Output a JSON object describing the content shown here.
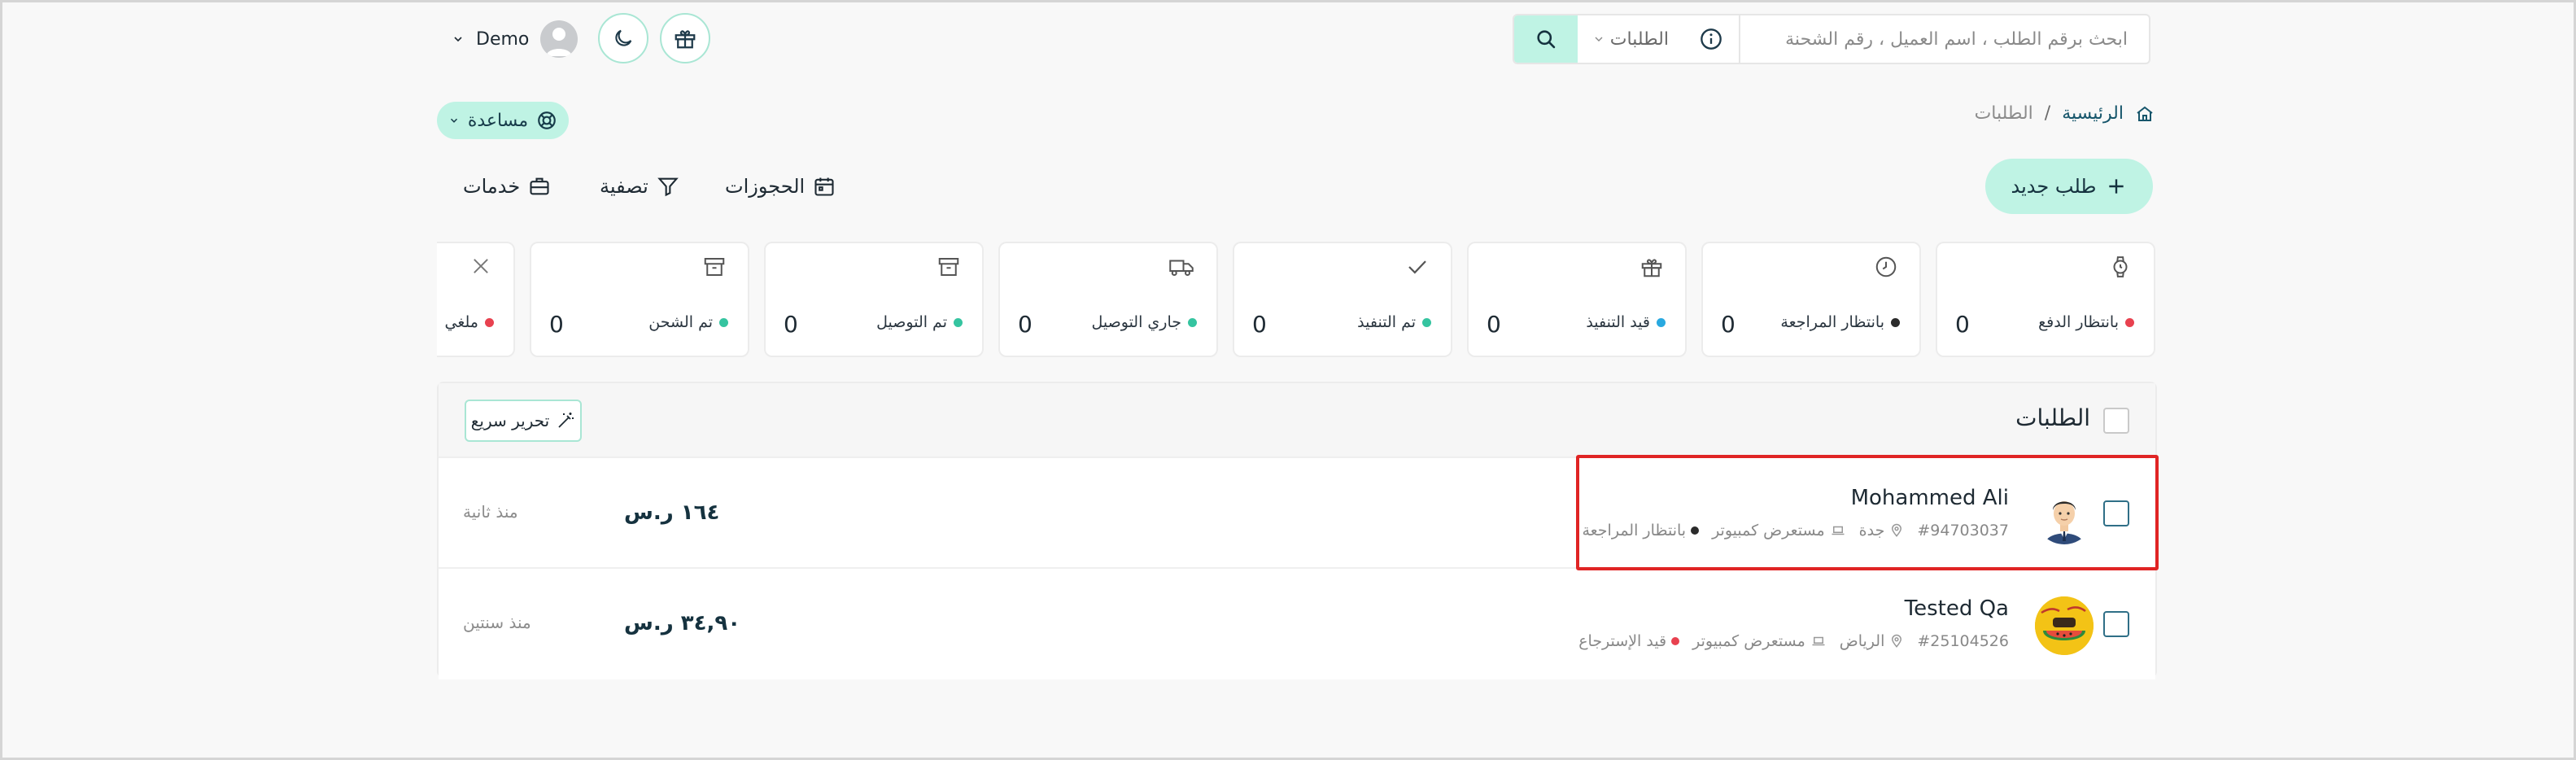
{
  "header": {
    "search_placeholder": "ابحث برقم الطلب ، اسم العميل ، رقم الشحنة",
    "scope_label": "الطلبات",
    "user_name": "Demo"
  },
  "breadcrumb": {
    "home": "الرئيسية",
    "separator": "/",
    "current": "الطلبات"
  },
  "help_label": "مساعدة",
  "actions": {
    "new_order": "طلب جديد",
    "bookings": "الحجوزات",
    "filter": "تصفية",
    "services": "خدمات"
  },
  "status_cards": [
    {
      "label": "بانتظار الدفع",
      "count": "0",
      "dot_color": "#e8414f",
      "icon": "watch-icon"
    },
    {
      "label": "بانتظار المراجعة",
      "count": "0",
      "dot_color": "#2b2b2b",
      "icon": "clock-icon"
    },
    {
      "label": "قيد التنفيذ",
      "count": "0",
      "dot_color": "#29a9e0",
      "icon": "gift-icon"
    },
    {
      "label": "تم التنفيذ",
      "count": "0",
      "dot_color": "#35c4a0",
      "icon": "check-icon"
    },
    {
      "label": "جاري التوصيل",
      "count": "0",
      "dot_color": "#35c4a0",
      "icon": "truck-icon"
    },
    {
      "label": "تم التوصيل",
      "count": "0",
      "dot_color": "#35c4a0",
      "icon": "archive-icon"
    },
    {
      "label": "تم الشحن",
      "count": "0",
      "dot_color": "#35c4a0",
      "icon": "archive-icon"
    },
    {
      "label": "ملغي",
      "count": "",
      "dot_color": "#e8414f",
      "icon": "close-icon"
    }
  ],
  "orders_panel": {
    "title": "الطلبات",
    "quick_edit": "تحرير سريع",
    "orders": [
      {
        "customer": "Mohammed Ali",
        "order_id": "#94703037",
        "city": "جدة",
        "source": "مستعرض كمبيوتر",
        "status": "بانتظار المراجعة",
        "status_color": "#2b2b2b",
        "price": "١٦٤ ر.س",
        "time": "منذ ثانية"
      },
      {
        "customer": "Tested Qa",
        "order_id": "#25104526",
        "city": "الرياض",
        "source": "مستعرض كمبيوتر",
        "status": "قيد الإسترجاع",
        "status_color": "#e8414f",
        "price": "٣٤,٩٠ ر.س",
        "time": "منذ سنتين"
      }
    ]
  },
  "colors": {
    "accent": "#bff3e4",
    "accent_border": "#a9e6d4",
    "highlight": "#e02424",
    "primary_text": "#15323f"
  }
}
